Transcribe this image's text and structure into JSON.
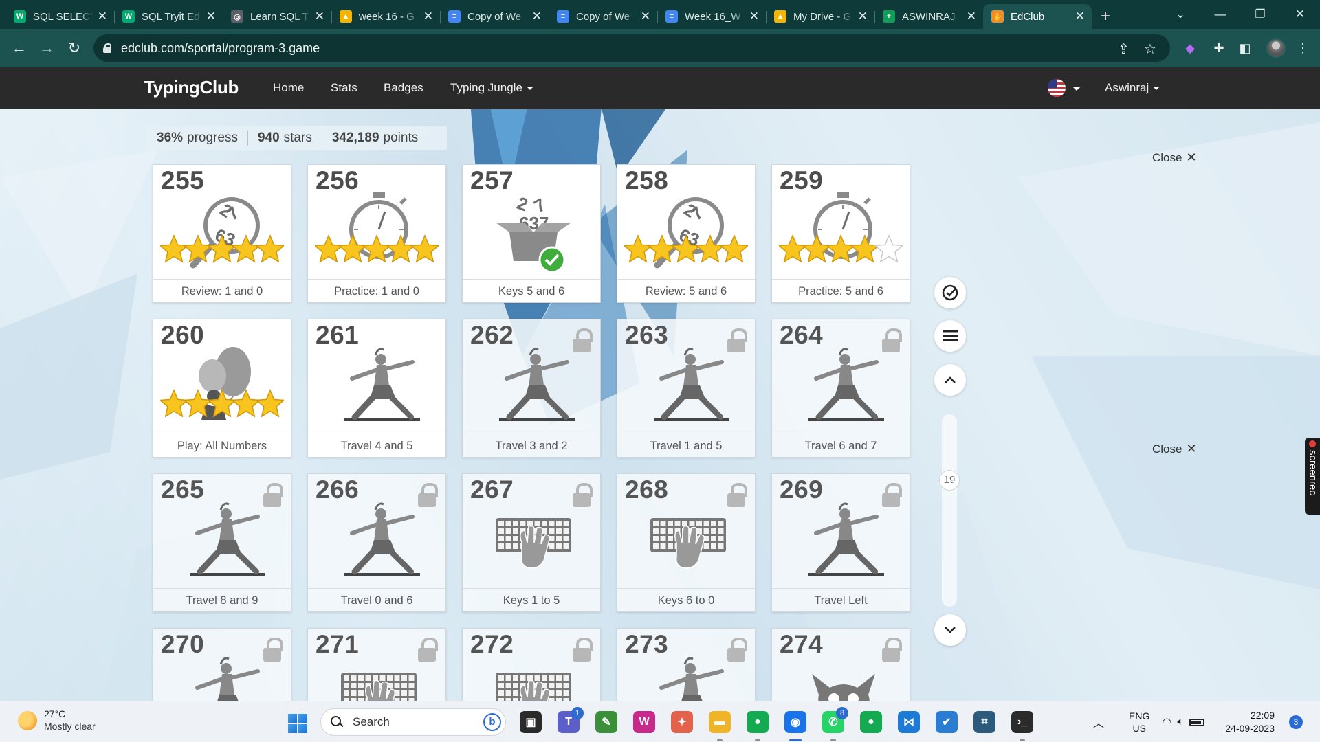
{
  "browser": {
    "tabs": [
      {
        "title": "SQL SELECT",
        "icon": "w3schools-icon",
        "color": "#04aa6d",
        "glyph": "W"
      },
      {
        "title": "SQL Tryit Ed",
        "icon": "w3schools-icon",
        "color": "#04aa6d",
        "glyph": "W"
      },
      {
        "title": "Learn SQL T",
        "icon": "openai-icon",
        "color": "#5b5f66",
        "glyph": "◎"
      },
      {
        "title": "week 16 - G",
        "icon": "google-drive-icon",
        "color": "#f4b400",
        "glyph": "▲"
      },
      {
        "title": "Copy of We",
        "icon": "google-docs-icon",
        "color": "#4285f4",
        "glyph": "≡"
      },
      {
        "title": "Copy of We",
        "icon": "google-docs-icon",
        "color": "#4285f4",
        "glyph": "≡"
      },
      {
        "title": "Week 16_W",
        "icon": "google-docs-icon",
        "color": "#4285f4",
        "glyph": "≡"
      },
      {
        "title": "My Drive - G",
        "icon": "google-drive-icon",
        "color": "#f4b400",
        "glyph": "▲"
      },
      {
        "title": "ASWINRAJ",
        "icon": "google-sheets-icon",
        "color": "#0f9d58",
        "glyph": "+"
      },
      {
        "title": "EdClub",
        "icon": "edclub-icon",
        "color": "#f08c2a",
        "glyph": "✋"
      }
    ],
    "active_tab": 9,
    "url": "edclub.com/sportal/program-3.game"
  },
  "site": {
    "brand": "TypingClub",
    "nav": [
      "Home",
      "Stats",
      "Badges",
      "Typing Jungle"
    ],
    "user": "Aswinraj"
  },
  "progress": {
    "percent": "36%",
    "percent_label": "progress",
    "stars": "940",
    "stars_label": "stars",
    "points": "342,189",
    "points_label": "points"
  },
  "close_label": "Close",
  "lessons": [
    {
      "num": "255",
      "label": "Review: 1 and 0",
      "art": "review",
      "stars": 5,
      "locked": false
    },
    {
      "num": "256",
      "label": "Practice: 1 and 0",
      "art": "stopwatch",
      "stars": 5,
      "locked": false
    },
    {
      "num": "257",
      "label": "Keys 5 and 6",
      "art": "box",
      "stars": 0,
      "locked": false
    },
    {
      "num": "258",
      "label": "Review: 5 and 6",
      "art": "review",
      "stars": 5,
      "locked": false
    },
    {
      "num": "259",
      "label": "Practice: 5 and 6",
      "art": "stopwatch",
      "stars": 4,
      "locked": false
    },
    {
      "num": "260",
      "label": "Play: All Numbers",
      "art": "balloon",
      "stars": 5,
      "locked": false
    },
    {
      "num": "261",
      "label": "Travel 4 and 5",
      "art": "yoga",
      "stars": 0,
      "locked": false
    },
    {
      "num": "262",
      "label": "Travel 3 and 2",
      "art": "yoga",
      "stars": 0,
      "locked": true
    },
    {
      "num": "263",
      "label": "Travel 1 and 5",
      "art": "yoga",
      "stars": 0,
      "locked": true
    },
    {
      "num": "264",
      "label": "Travel 6 and 7",
      "art": "yoga",
      "stars": 0,
      "locked": true
    },
    {
      "num": "265",
      "label": "Travel 8 and 9",
      "art": "yoga",
      "stars": 0,
      "locked": true
    },
    {
      "num": "266",
      "label": "Travel 0 and 6",
      "art": "yoga",
      "stars": 0,
      "locked": true
    },
    {
      "num": "267",
      "label": "Keys 1 to 5",
      "art": "keyboard",
      "stars": 0,
      "locked": true
    },
    {
      "num": "268",
      "label": "Keys 6 to 0",
      "art": "keyboard",
      "stars": 0,
      "locked": true
    },
    {
      "num": "269",
      "label": "Travel Left",
      "art": "yoga",
      "stars": 0,
      "locked": true
    },
    {
      "num": "270",
      "label": "",
      "art": "yoga",
      "stars": 0,
      "locked": true
    },
    {
      "num": "271",
      "label": "",
      "art": "keyboard",
      "stars": 0,
      "locked": true
    },
    {
      "num": "272",
      "label": "",
      "art": "keyboard",
      "stars": 0,
      "locked": true
    },
    {
      "num": "273",
      "label": "",
      "art": "yoga",
      "stars": 0,
      "locked": true
    },
    {
      "num": "274",
      "label": "",
      "art": "monster",
      "stars": 0,
      "locked": true
    }
  ],
  "scroll_position": "19",
  "screenrec_label": "screenrec",
  "taskbar": {
    "temp": "27°C",
    "weather": "Mostly clear",
    "search_placeholder": "Search",
    "apps": [
      {
        "name": "task-view-icon",
        "color": "#2a2a2a",
        "glyph": "▣",
        "running": false,
        "badge": ""
      },
      {
        "name": "teams-icon",
        "color": "#5b5fc7",
        "glyph": "T",
        "running": false,
        "badge": "1"
      },
      {
        "name": "photo-app-icon",
        "color": "#3b8f3b",
        "glyph": "✎",
        "running": false,
        "badge": ""
      },
      {
        "name": "wps-icon",
        "color": "#c82a8c",
        "glyph": "W",
        "running": false,
        "badge": ""
      },
      {
        "name": "pinwheel-app-icon",
        "color": "#e2624c",
        "glyph": "✦",
        "running": false,
        "badge": ""
      },
      {
        "name": "file-explorer-icon",
        "color": "#f0b429",
        "glyph": "▬",
        "running": true,
        "badge": ""
      },
      {
        "name": "mongodb-icon",
        "color": "#13aa52",
        "glyph": "●",
        "running": true,
        "badge": ""
      },
      {
        "name": "chrome-icon",
        "color": "#1a73e8",
        "glyph": "◉",
        "running": true,
        "badge": "",
        "active": true
      },
      {
        "name": "whatsapp-icon",
        "color": "#25d366",
        "glyph": "✆",
        "running": true,
        "badge": "8"
      },
      {
        "name": "mongodb-compass-icon",
        "color": "#13aa52",
        "glyph": "●",
        "running": false,
        "badge": ""
      },
      {
        "name": "vscode-icon",
        "color": "#1f7ad6",
        "glyph": "⋈",
        "running": false,
        "badge": ""
      },
      {
        "name": "todo-icon",
        "color": "#2b7cd3",
        "glyph": "✔",
        "running": false,
        "badge": ""
      },
      {
        "name": "mysql-workbench-icon",
        "color": "#2d5a7b",
        "glyph": "⌗",
        "running": false,
        "badge": ""
      },
      {
        "name": "terminal-icon",
        "color": "#2b2b2b",
        "glyph": "›_",
        "running": true,
        "badge": ""
      }
    ],
    "lang": "ENG",
    "region": "US",
    "time": "22:09",
    "date": "24-09-2023",
    "notifications": "3"
  }
}
